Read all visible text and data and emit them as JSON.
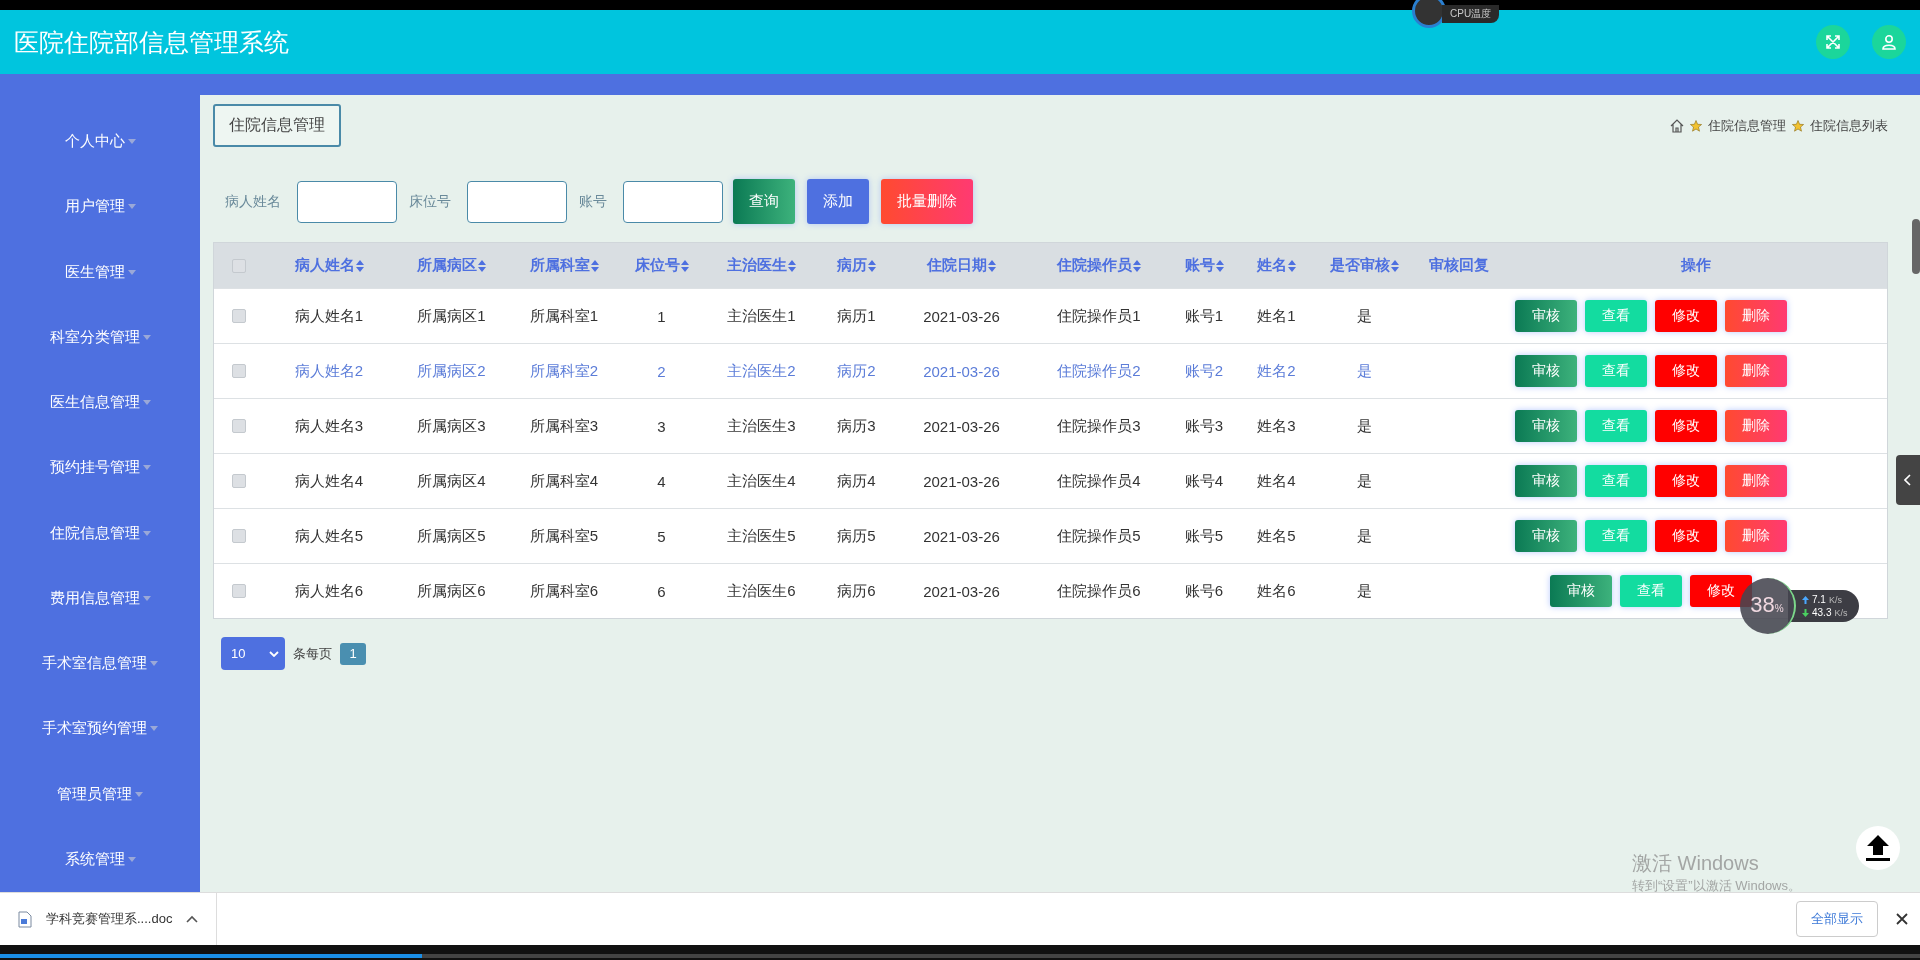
{
  "header": {
    "title": "医院住院部信息管理系统"
  },
  "sidebar": {
    "items": [
      "个人中心",
      "用户管理",
      "医生管理",
      "科室分类管理",
      "医生信息管理",
      "预约挂号管理",
      "住院信息管理",
      "费用信息管理",
      "手术室信息管理",
      "手术室预约管理",
      "管理员管理",
      "系统管理"
    ]
  },
  "page_title_button": "住院信息管理",
  "breadcrumb": [
    "住院信息管理",
    "住院信息列表"
  ],
  "search": {
    "fields": [
      {
        "label": "病人姓名"
      },
      {
        "label": "床位号"
      },
      {
        "label": "账号"
      }
    ],
    "buttons": [
      {
        "label": "查询",
        "kind": "query"
      },
      {
        "label": "添加",
        "kind": "add"
      },
      {
        "label": "批量删除",
        "kind": "batch_delete"
      }
    ]
  },
  "table": {
    "all_checked": false,
    "columns": [
      {
        "label": "病人姓名",
        "sortable": true
      },
      {
        "label": "所属病区",
        "sortable": true
      },
      {
        "label": "所属科室",
        "sortable": true
      },
      {
        "label": "床位号",
        "sortable": true
      },
      {
        "label": "主治医生",
        "sortable": true
      },
      {
        "label": "病历",
        "sortable": true
      },
      {
        "label": "住院日期",
        "sortable": true
      },
      {
        "label": "住院操作员",
        "sortable": true
      },
      {
        "label": "账号",
        "sortable": true
      },
      {
        "label": "姓名",
        "sortable": true
      },
      {
        "label": "是否审核",
        "sortable": true
      },
      {
        "label": "审核回复",
        "sortable": false
      },
      {
        "label": "操作",
        "sortable": false
      }
    ],
    "rows": [
      {
        "checked": false,
        "hovered": false,
        "cells": [
          "病人姓名1",
          "所属病区1",
          "所属科室1",
          "1",
          "主治医生1",
          "病历1",
          "2021-03-26",
          "住院操作员1",
          "账号1",
          "姓名1",
          "是"
        ],
        "actions": [
          {
            "label": "审核",
            "kind": "review"
          },
          {
            "label": "查看",
            "kind": "view"
          },
          {
            "label": "修改",
            "kind": "edit"
          },
          {
            "label": "删除",
            "kind": "delete"
          }
        ]
      },
      {
        "checked": false,
        "hovered": true,
        "cells": [
          "病人姓名2",
          "所属病区2",
          "所属科室2",
          "2",
          "主治医生2",
          "病历2",
          "2021-03-26",
          "住院操作员2",
          "账号2",
          "姓名2",
          "是"
        ],
        "actions": [
          {
            "label": "审核",
            "kind": "review"
          },
          {
            "label": "查看",
            "kind": "view"
          },
          {
            "label": "修改",
            "kind": "edit"
          },
          {
            "label": "删除",
            "kind": "delete"
          }
        ]
      },
      {
        "checked": false,
        "hovered": false,
        "cells": [
          "病人姓名3",
          "所属病区3",
          "所属科室3",
          "3",
          "主治医生3",
          "病历3",
          "2021-03-26",
          "住院操作员3",
          "账号3",
          "姓名3",
          "是"
        ],
        "actions": [
          {
            "label": "审核",
            "kind": "review"
          },
          {
            "label": "查看",
            "kind": "view"
          },
          {
            "label": "修改",
            "kind": "edit"
          },
          {
            "label": "删除",
            "kind": "delete"
          }
        ]
      },
      {
        "checked": false,
        "hovered": false,
        "cells": [
          "病人姓名4",
          "所属病区4",
          "所属科室4",
          "4",
          "主治医生4",
          "病历4",
          "2021-03-26",
          "住院操作员4",
          "账号4",
          "姓名4",
          "是"
        ],
        "actions": [
          {
            "label": "审核",
            "kind": "review"
          },
          {
            "label": "查看",
            "kind": "view"
          },
          {
            "label": "修改",
            "kind": "edit"
          },
          {
            "label": "删除",
            "kind": "delete"
          }
        ]
      },
      {
        "checked": false,
        "hovered": false,
        "cells": [
          "病人姓名5",
          "所属病区5",
          "所属科室5",
          "5",
          "主治医生5",
          "病历5",
          "2021-03-26",
          "住院操作员5",
          "账号5",
          "姓名5",
          "是"
        ],
        "actions": [
          {
            "label": "审核",
            "kind": "review"
          },
          {
            "label": "查看",
            "kind": "view"
          },
          {
            "label": "修改",
            "kind": "edit"
          },
          {
            "label": "删除",
            "kind": "delete"
          }
        ]
      },
      {
        "checked": false,
        "hovered": false,
        "cells": [
          "病人姓名6",
          "所属病区6",
          "所属科室6",
          "6",
          "主治医生6",
          "病历6",
          "2021-03-26",
          "住院操作员6",
          "账号6",
          "姓名6",
          "是"
        ],
        "actions": [
          {
            "label": "审核",
            "kind": "review"
          },
          {
            "label": "查看",
            "kind": "view"
          },
          {
            "label": "修改",
            "kind": "edit"
          }
        ]
      }
    ]
  },
  "pagination": {
    "page_size": "10",
    "per_page_label": "条每页",
    "pages": [
      {
        "label": "1",
        "selected": true
      }
    ]
  },
  "download_bar": {
    "file": "学科竞赛管理系....doc",
    "show_all": "全部显示"
  },
  "cpu_widget": {
    "label": "CPU温度"
  },
  "net_widget": {
    "percent": "38",
    "unit": "%",
    "up": "7.1",
    "up_unit": "K/s",
    "down": "43.3",
    "down_unit": "K/s"
  },
  "windows_notice": {
    "title": "激活 Windows",
    "subtitle": "转到“设置”以激活 Windows。"
  },
  "player": {
    "level": 0.22
  }
}
